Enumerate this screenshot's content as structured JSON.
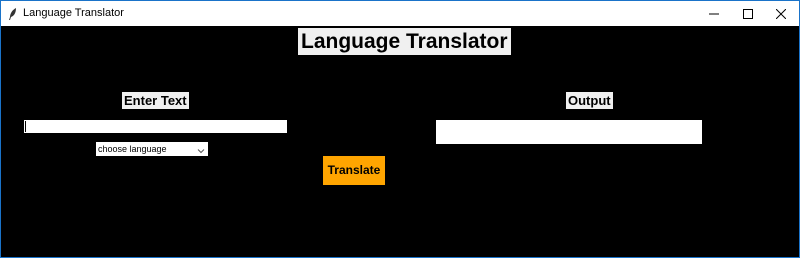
{
  "window": {
    "title": "Language Translator"
  },
  "app": {
    "title": "Language Translator",
    "input_label": "Enter Text",
    "output_label": "Output",
    "input_value": "",
    "output_value": "",
    "language_select": {
      "selected": "choose language"
    },
    "translate_button": "Translate"
  },
  "colors": {
    "background": "#000000",
    "button": "#ffa500",
    "label_bg": "#f0f0f0"
  },
  "icons": {
    "window": "feather-icon",
    "minimize": "minimize-icon",
    "maximize": "maximize-icon",
    "close": "close-icon",
    "dropdown": "chevron-down-icon"
  }
}
